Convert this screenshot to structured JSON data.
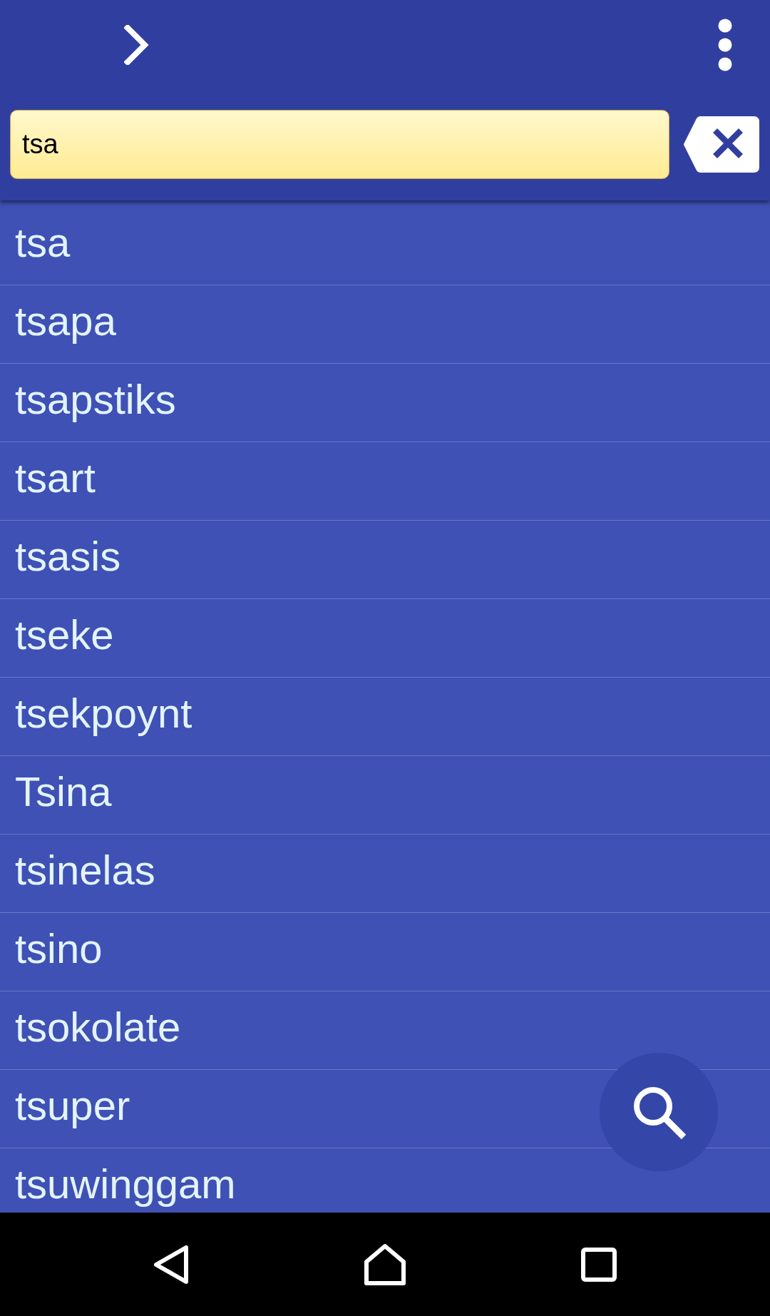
{
  "search": {
    "value": "tsa"
  },
  "results": [
    "tsa",
    "tsapa",
    "tsapstiks",
    "tsart",
    "tsasis",
    "tseke",
    "tsekpoynt",
    "Tsina",
    "tsinelas",
    "tsino",
    "tsokolate",
    "tsuper",
    "tsuwinggam"
  ]
}
